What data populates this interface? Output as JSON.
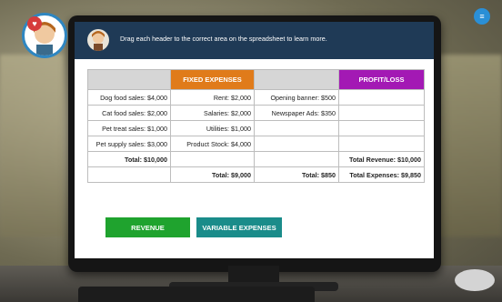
{
  "header": {
    "instruction": "Drag each header to the correct area on the spreadsheet to learn more."
  },
  "icons": {
    "heart": "heart-icon",
    "menu": "menu-icon",
    "avatar": "avatar-icon"
  },
  "colors": {
    "header_bar": "#1f3a56",
    "fixed_expenses": "#e07b1a",
    "profit_loss": "#a319b4",
    "revenue_button": "#1fa32e",
    "variable_button": "#1a8c8a"
  },
  "spreadsheet": {
    "headers": [
      "",
      "FIXED EXPENSES",
      "",
      "PROFIT/LOSS"
    ],
    "rows": [
      [
        "Dog food sales: $4,000",
        "Rent: $2,000",
        "Opening banner: $500",
        ""
      ],
      [
        "Cat food sales: $2,000",
        "Salaries: $2,000",
        "Newspaper Ads: $350",
        ""
      ],
      [
        "Pet treat sales: $1,000",
        "Utilities: $1,000",
        "",
        ""
      ],
      [
        "Pet supply sales: $3,000",
        "Product Stock: $4,000",
        "",
        ""
      ],
      [
        "Total: $10,000",
        "",
        "",
        "Total Revenue: $10,000"
      ],
      [
        "",
        "Total: $9,000",
        "Total: $850",
        "Total Expenses: $9,850"
      ]
    ]
  },
  "drag_buttons": {
    "revenue": "REVENUE",
    "variable_expenses": "VARIABLE EXPENSES"
  }
}
